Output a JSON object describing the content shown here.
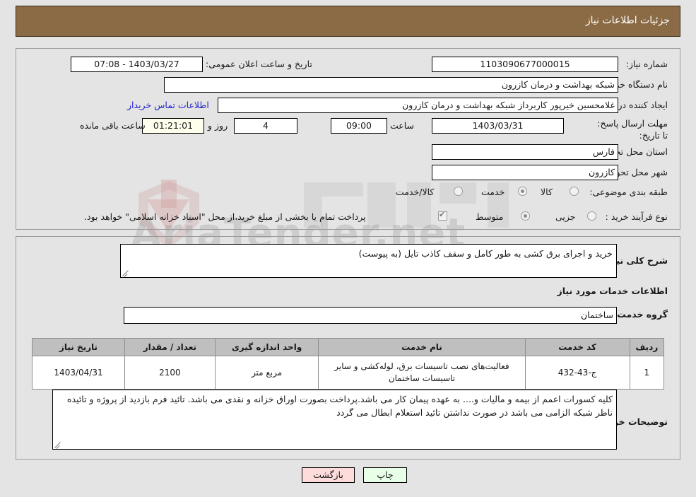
{
  "header": {
    "title": "جزئیات اطلاعات نیاز"
  },
  "summary": {
    "need_number_label": "شماره نیاز:",
    "need_number_value": "1103090677000015",
    "announce_label": "تاریخ و ساعت اعلان عمومی:",
    "announce_value": "1403/03/27 - 07:08",
    "buyer_org_label": "نام دستگاه خریدار:",
    "buyer_org_value": "شبکه بهداشت و درمان کازرون",
    "creator_label": "ایجاد کننده درخواست:",
    "creator_value": "غلامحسین  خیرپور  کاربرداز شبکه بهداشت و درمان کازرون",
    "buyer_contact_link": "اطلاعات تماس خریدار",
    "deadline_label": "مهلت ارسال پاسخ: تا تاریخ:",
    "deadline_date": "1403/03/31",
    "deadline_hour_label": "ساعت",
    "deadline_hour": "09:00",
    "days_remaining": "4",
    "days_word": "روز و",
    "time_remaining": "01:21:01",
    "hours_remaining_label": "ساعت باقی مانده",
    "province_label": "استان محل تحویل:",
    "province_value": "فارس",
    "city_label": "شهر محل تحویل:",
    "city_value": "کازرون",
    "category_label": "طبقه بندی موضوعی:",
    "category_options": [
      {
        "label": "کالا",
        "selected": false
      },
      {
        "label": "خدمت",
        "selected": true
      },
      {
        "label": "کالا/خدمت",
        "selected": false
      }
    ],
    "process_label": "نوع فرآیند خرید :",
    "process_options": [
      {
        "label": "جزیی",
        "selected": false
      },
      {
        "label": "متوسط",
        "selected": true
      }
    ],
    "treasury_checkbox_label": "پرداخت تمام یا بخشی از مبلغ خرید،از محل \"اسناد خزانه اسلامی\" خواهد بود.",
    "treasury_checked": true
  },
  "details": {
    "general_desc_label": "شرح کلی نیاز:",
    "general_desc_value": "خرید و اجرای برق کشی به طور کامل و سقف کاذب تایل (به پیوست)",
    "services_section_title": "اطلاعات خدمات مورد نیاز",
    "service_group_label": "گروه خدمت:",
    "service_group_value": "ساختمان"
  },
  "table": {
    "columns": [
      "ردیف",
      "کد خدمت",
      "نام خدمت",
      "واحد اندازه گیری",
      "تعداد / مقدار",
      "تاریخ نیاز"
    ],
    "rows": [
      {
        "row_no": "1",
        "service_code": "ج-43-432",
        "service_name": "فعالیت‌های نصب تاسیسات برق، لوله‌کشی و سایر تاسیسات ساختمان",
        "unit": "مربع متر",
        "quantity": "2100",
        "need_date": "1403/04/31"
      }
    ]
  },
  "notes": {
    "label": "توضیحات خریدار:",
    "value": "کلیه کسورات اعمم از بیمه و مالیات و.... به عهده پیمان کار می باشد.پرداخت بصورت اوراق خزانه و نقدی می باشد.  تائید فرم بازدید از پروژه و تائیده ناظر شبکه الزامی می باشد در صورت نداشتن تائید استعلام ابطال می گردد"
  },
  "buttons": {
    "print": "چاپ",
    "back": "بازگشت"
  },
  "watermark": {
    "text": "AriaTender.net"
  }
}
